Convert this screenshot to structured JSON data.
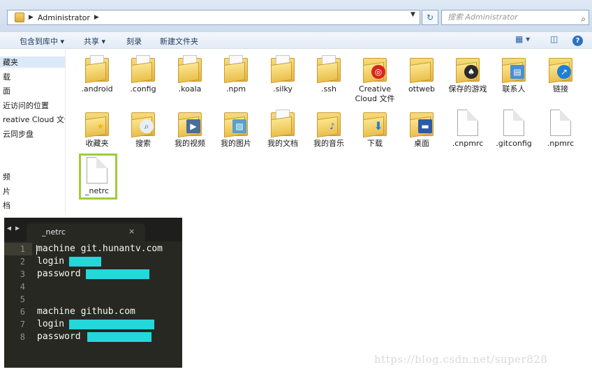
{
  "address": {
    "path": "Administrator",
    "search_placeholder": "搜索 Administrator"
  },
  "toolbar": {
    "include_library": "包含到库中 ▾",
    "share": "共享 ▾",
    "burn": "刻录",
    "new_folder": "新建文件夹",
    "help": "?"
  },
  "nav": {
    "items": [
      "藏夹",
      "载",
      "面",
      "近访问的位置",
      "reative Cloud 文件",
      "云同步盘",
      "频",
      "片",
      "档"
    ]
  },
  "files": [
    {
      "label": ".android",
      "kind": "folder"
    },
    {
      "label": ".config",
      "kind": "folder"
    },
    {
      "label": ".koala",
      "kind": "folder"
    },
    {
      "label": ".npm",
      "kind": "folder"
    },
    {
      "label": ".silky",
      "kind": "folder"
    },
    {
      "label": ".ssh",
      "kind": "folder"
    },
    {
      "label": "Creative Cloud 文件",
      "kind": "folder-cc"
    },
    {
      "label": "ottweb",
      "kind": "folder"
    },
    {
      "label": "保存的游戏",
      "kind": "folder-games"
    },
    {
      "label": "联系人",
      "kind": "folder-contacts"
    },
    {
      "label": "链接",
      "kind": "folder-links"
    },
    {
      "label": "收藏夹",
      "kind": "folder-fav"
    },
    {
      "label": "搜索",
      "kind": "folder-search"
    },
    {
      "label": "我的视频",
      "kind": "folder-video"
    },
    {
      "label": "我的图片",
      "kind": "folder-pictures"
    },
    {
      "label": "我的文档",
      "kind": "folder-docs"
    },
    {
      "label": "我的音乐",
      "kind": "folder-music"
    },
    {
      "label": "下载",
      "kind": "folder-download"
    },
    {
      "label": "桌面",
      "kind": "folder-desktop"
    },
    {
      "label": ".cnpmrc",
      "kind": "file"
    },
    {
      "label": ".gitconfig",
      "kind": "file"
    },
    {
      "label": ".npmrc",
      "kind": "file"
    },
    {
      "label": "_netrc",
      "kind": "file",
      "selected": true
    }
  ],
  "editor": {
    "tab_label": "_netrc",
    "close": "×",
    "nav_arrows": "◀ ▶",
    "lines": [
      {
        "num": "1",
        "text": "machine git.hunantv.com"
      },
      {
        "num": "2",
        "text": "login"
      },
      {
        "num": "3",
        "text": "password"
      },
      {
        "num": "4",
        "text": ""
      },
      {
        "num": "5",
        "text": ""
      },
      {
        "num": "6",
        "text": "machine github.com"
      },
      {
        "num": "7",
        "text": "login"
      },
      {
        "num": "8",
        "text": "password"
      }
    ],
    "redaction_color": "#24d7d9"
  },
  "watermark": "https://blog.csdn.net/super828"
}
